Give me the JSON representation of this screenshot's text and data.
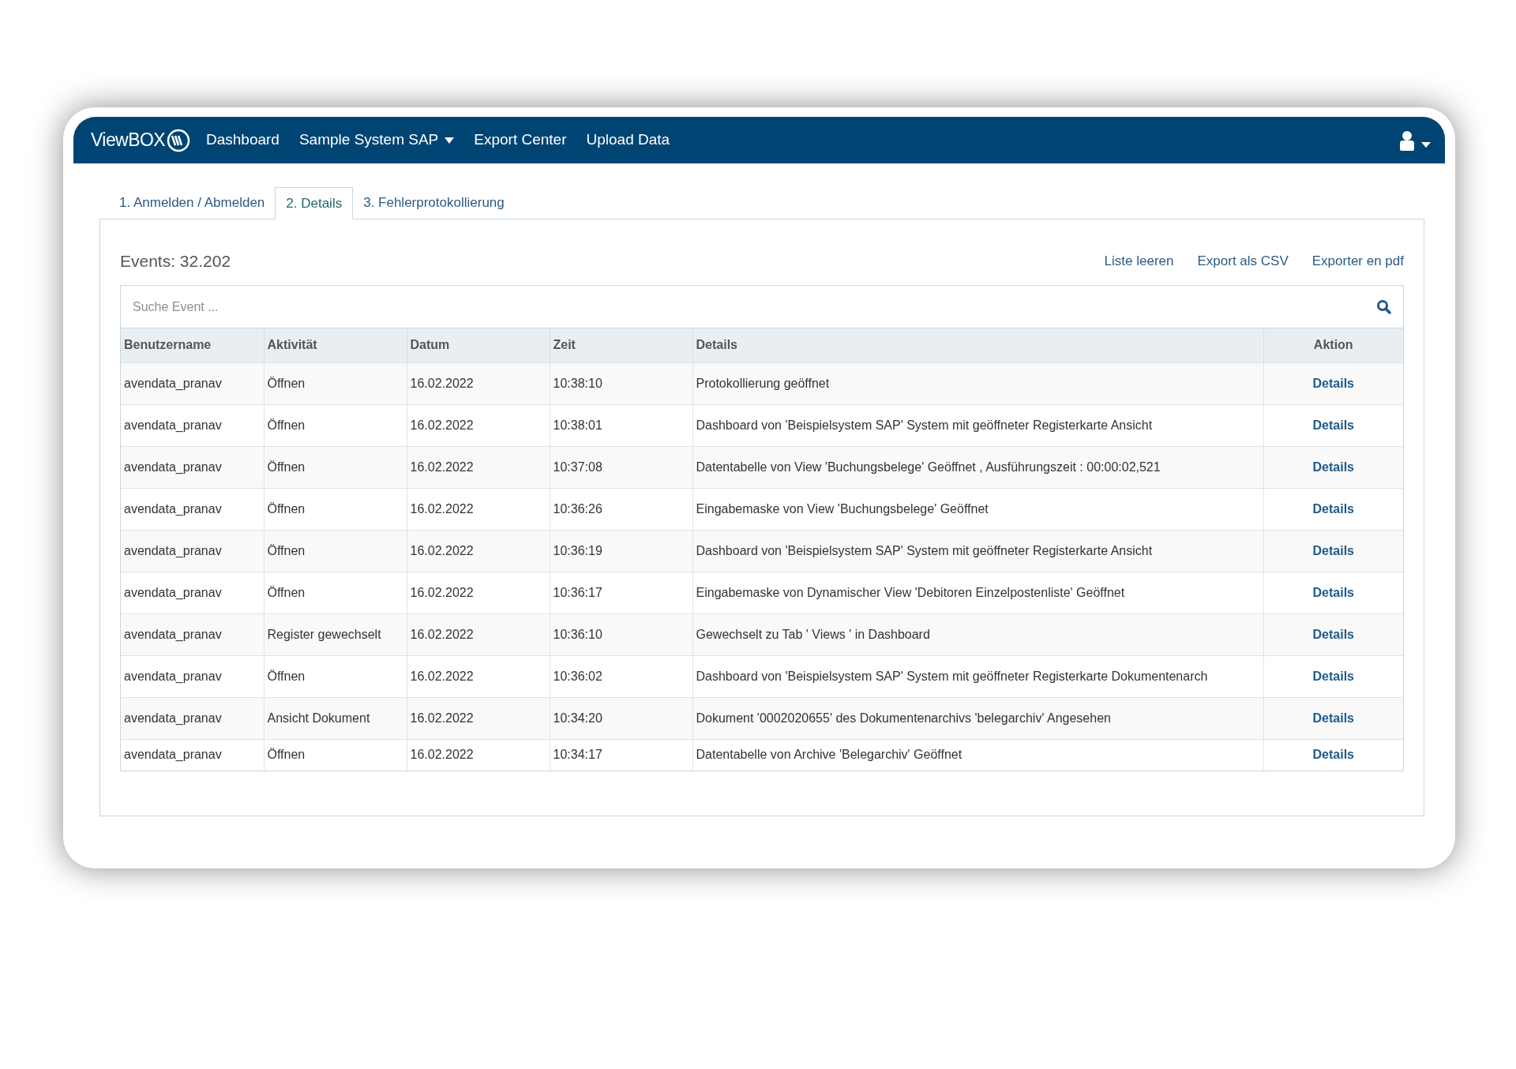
{
  "nav": {
    "logo": "ViewBOX",
    "items": [
      {
        "label": "Dashboard",
        "dropdown": false
      },
      {
        "label": "Sample System SAP",
        "dropdown": true
      },
      {
        "label": "Export Center",
        "dropdown": false
      },
      {
        "label": "Upload Data",
        "dropdown": false
      }
    ]
  },
  "tabs": [
    {
      "label": "1. Anmelden / Abmelden",
      "selected": false
    },
    {
      "label": "2. Details",
      "selected": true
    },
    {
      "label": "3. Fehlerprotokollierung",
      "selected": false
    }
  ],
  "events_count": "Events: 32.202",
  "actions": [
    "Liste leeren",
    "Export als CSV",
    "Exporter en pdf"
  ],
  "search": {
    "placeholder": "Suche Event ..."
  },
  "table": {
    "columns": [
      "Benutzername",
      "Aktivität",
      "Datum",
      "Zeit",
      "Details",
      "Aktion"
    ],
    "rows": [
      [
        "avendata_pranav",
        "Öffnen",
        "16.02.2022",
        "10:38:10",
        "Protokollierung geöffnet",
        "Details"
      ],
      [
        "avendata_pranav",
        "Öffnen",
        "16.02.2022",
        "10:38:01",
        "Dashboard von 'Beispielsystem SAP' System mit geöffneter Registerkarte Ansicht",
        "Details"
      ],
      [
        "avendata_pranav",
        "Öffnen",
        "16.02.2022",
        "10:37:08",
        "Datentabelle von View 'Buchungsbelege' Geöffnet , Ausführungszeit : 00:00:02,521",
        "Details"
      ],
      [
        "avendata_pranav",
        "Öffnen",
        "16.02.2022",
        "10:36:26",
        "Eingabemaske von View 'Buchungsbelege' Geöffnet",
        "Details"
      ],
      [
        "avendata_pranav",
        "Öffnen",
        "16.02.2022",
        "10:36:19",
        "Dashboard von 'Beispielsystem SAP' System mit geöffneter Registerkarte Ansicht",
        "Details"
      ],
      [
        "avendata_pranav",
        "Öffnen",
        "16.02.2022",
        "10:36:17",
        "Eingabemaske von Dynamischer View 'Debitoren Einzelpostenliste' Geöffnet",
        "Details"
      ],
      [
        "avendata_pranav",
        "Register gewechselt",
        "16.02.2022",
        "10:36:10",
        "Gewechselt zu Tab ' Views ' in Dashboard",
        "Details"
      ],
      [
        "avendata_pranav",
        "Öffnen",
        "16.02.2022",
        "10:36:02",
        "Dashboard von 'Beispielsystem SAP' System mit geöffneter Registerkarte Dokumentenarch",
        "Details"
      ],
      [
        "avendata_pranav",
        "Ansicht Dokument",
        "16.02.2022",
        "10:34:20",
        "Dokument '0002020655' des Dokumentenarchivs 'belegarchiv' Angesehen",
        "Details"
      ],
      [
        "avendata_pranav",
        "Öffnen",
        "16.02.2022",
        "10:34:17",
        "Datentabelle von Archive 'Belegarchiv' Geöffnet",
        "Details"
      ]
    ]
  }
}
